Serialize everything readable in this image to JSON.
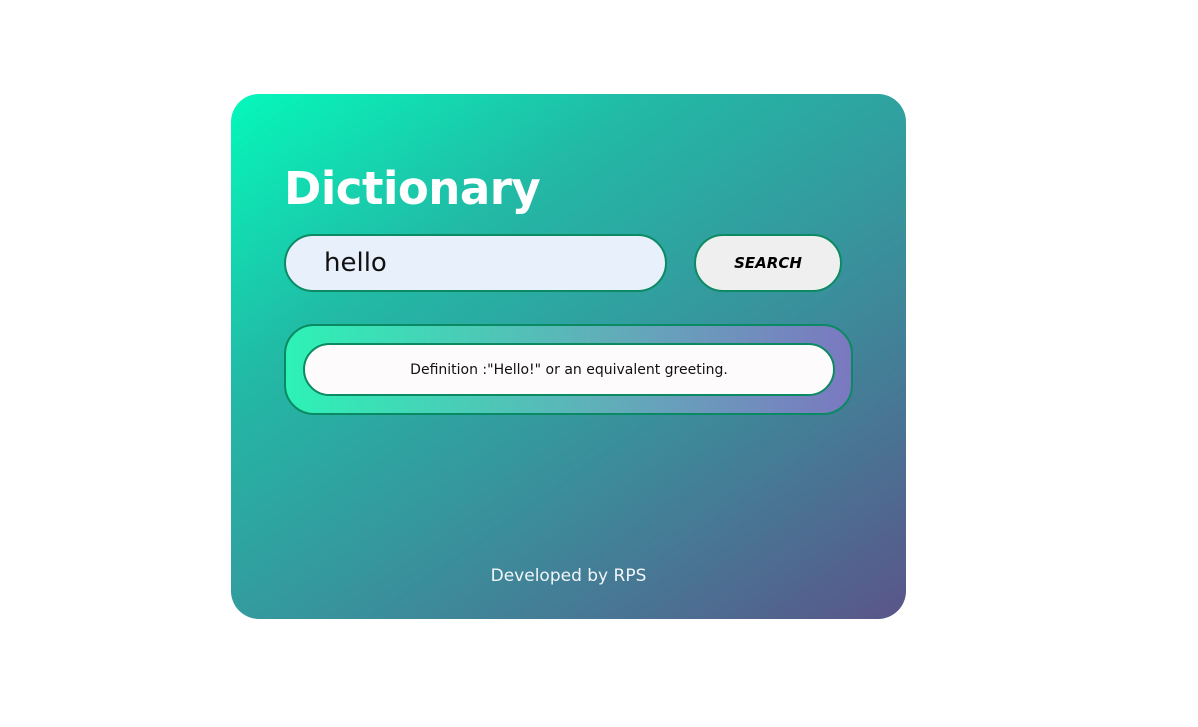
{
  "app": {
    "title": "Dictionary"
  },
  "search": {
    "value": "hello",
    "button_label": "SEARCH"
  },
  "result": {
    "definition": "Definition :\"Hello!\" or an equivalent greeting."
  },
  "footer": {
    "text": "Developed by RPS"
  },
  "colors": {
    "gradient_start": "#05f8bb",
    "gradient_end": "#5a5589",
    "border_accent": "#0b8a63",
    "input_background": "#e8f0fb",
    "button_background": "#efefef"
  }
}
